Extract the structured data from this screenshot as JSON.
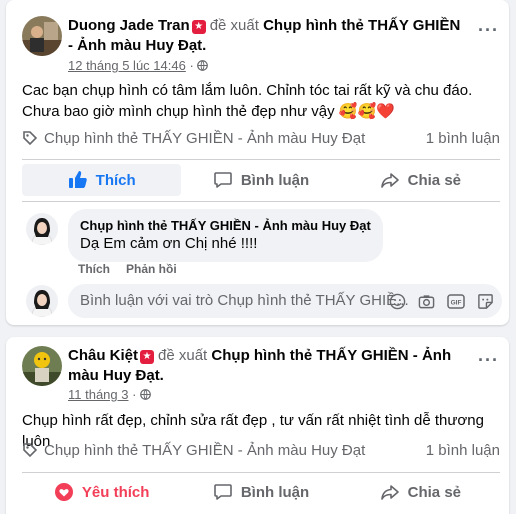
{
  "post1": {
    "author": "Duong Jade Tran",
    "recommends": "đề xuất",
    "page": "Chụp hình thẻ THẤY GHIỀN - Ảnh màu Huy Đạt.",
    "timestamp": "12 tháng 5 lúc 14:46",
    "text": "Cac bạn chụp hình có tâm lắm luôn. Chỉnh tóc tai rất kỹ và chu đáo. Chưa bao giờ mình chụp hình thẻ đẹp như vậy 🥰🥰❤️",
    "tag": "Chụp hình thẻ THẤY GHIỀN - Ảnh màu Huy Đạt",
    "comment_count": "1 bình luận",
    "actions": {
      "like": "Thích",
      "comment": "Bình luận",
      "share": "Chia sẻ"
    },
    "comment": {
      "author": "Chụp hình thẻ THẤY GHIỀN - Ảnh màu Huy Đạt",
      "text": "Dạ Em cảm ơn Chị nhé !!!!",
      "like": "Thích",
      "reply": "Phản hồi"
    },
    "input_placeholder": "Bình luận với vai trò Chụp hình thẻ THẤY GHIỀ..."
  },
  "post2": {
    "author": "Châu Kiệt",
    "recommends": "đề xuất",
    "page": "Chụp hình thẻ THẤY GHIỀN - Ảnh màu Huy Đạt.",
    "timestamp": "11 tháng 3",
    "text": "Chụp hình rất đẹp, chỉnh sửa rất đẹp , tư vấn rất nhiệt tình dễ thương luôn",
    "tag": "Chụp hình thẻ THẤY GHIỀN - Ảnh màu Huy Đạt",
    "comment_count": "1 bình luận",
    "actions": {
      "like": "Yêu thích",
      "comment": "Bình luận",
      "share": "Chia sẻ"
    }
  },
  "colors": {
    "blue": "#1877f2",
    "love": "#f33e58",
    "muted": "#65676b"
  }
}
